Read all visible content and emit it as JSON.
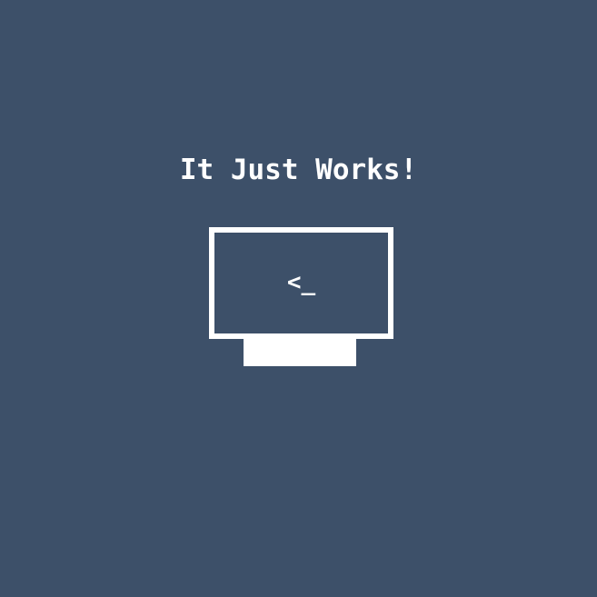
{
  "headline": "It Just Works!",
  "terminal": {
    "prompt": "<_"
  },
  "icons": {
    "monitor": "terminal-monitor-icon",
    "stand": "monitor-stand-icon"
  },
  "colors": {
    "background": "#3d5069",
    "foreground": "#ffffff"
  }
}
